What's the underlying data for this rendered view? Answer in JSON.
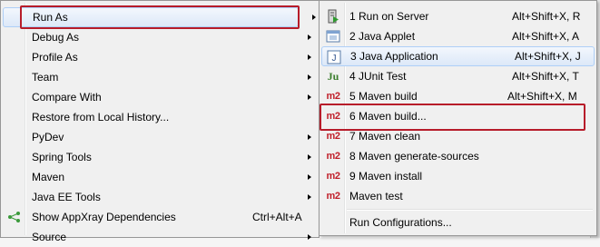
{
  "main_menu": {
    "items": [
      {
        "label": "Run As",
        "accel": ""
      },
      {
        "label": "Debug As",
        "accel": ""
      },
      {
        "label": "Profile As",
        "accel": ""
      },
      {
        "label": "Team",
        "accel": ""
      },
      {
        "label": "Compare With",
        "accel": ""
      },
      {
        "label": "Restore from Local History...",
        "accel": ""
      },
      {
        "label": "PyDev",
        "accel": ""
      },
      {
        "label": "Spring Tools",
        "accel": ""
      },
      {
        "label": "Maven",
        "accel": ""
      },
      {
        "label": "Java EE Tools",
        "accel": ""
      },
      {
        "label": "Show AppXray Dependencies",
        "accel": "Ctrl+Alt+A"
      },
      {
        "label": "Source",
        "accel": ""
      }
    ]
  },
  "run_as_submenu": {
    "items": [
      {
        "label": "1 Run on Server",
        "accel": "Alt+Shift+X, R",
        "icon": "server-icon"
      },
      {
        "label": "2 Java Applet",
        "accel": "Alt+Shift+X, A",
        "icon": "applet-icon"
      },
      {
        "label": "3 Java Application",
        "accel": "Alt+Shift+X, J",
        "icon": "java-app-icon"
      },
      {
        "label": "4 JUnit Test",
        "accel": "Alt+Shift+X, T",
        "icon": "junit-icon"
      },
      {
        "label": "5 Maven build",
        "accel": "Alt+Shift+X, M",
        "icon": "m2-icon"
      },
      {
        "label": "6 Maven build...",
        "accel": "",
        "icon": "m2-icon"
      },
      {
        "label": "7 Maven clean",
        "accel": "",
        "icon": "m2-icon"
      },
      {
        "label": "8 Maven generate-sources",
        "accel": "",
        "icon": "m2-icon"
      },
      {
        "label": "9 Maven install",
        "accel": "",
        "icon": "m2-icon"
      },
      {
        "label": "Maven test",
        "accel": "",
        "icon": "m2-icon"
      },
      {
        "label": "Run Configurations...",
        "accel": "",
        "icon": ""
      }
    ]
  },
  "icons": {
    "m2": "m2",
    "junit": "Ju",
    "java_app": "J"
  },
  "colors": {
    "highlight_border": "#b71c2a",
    "hover_background": "#dce8f8",
    "hover_border": "#aecff7",
    "m2_red": "#c0202b"
  }
}
